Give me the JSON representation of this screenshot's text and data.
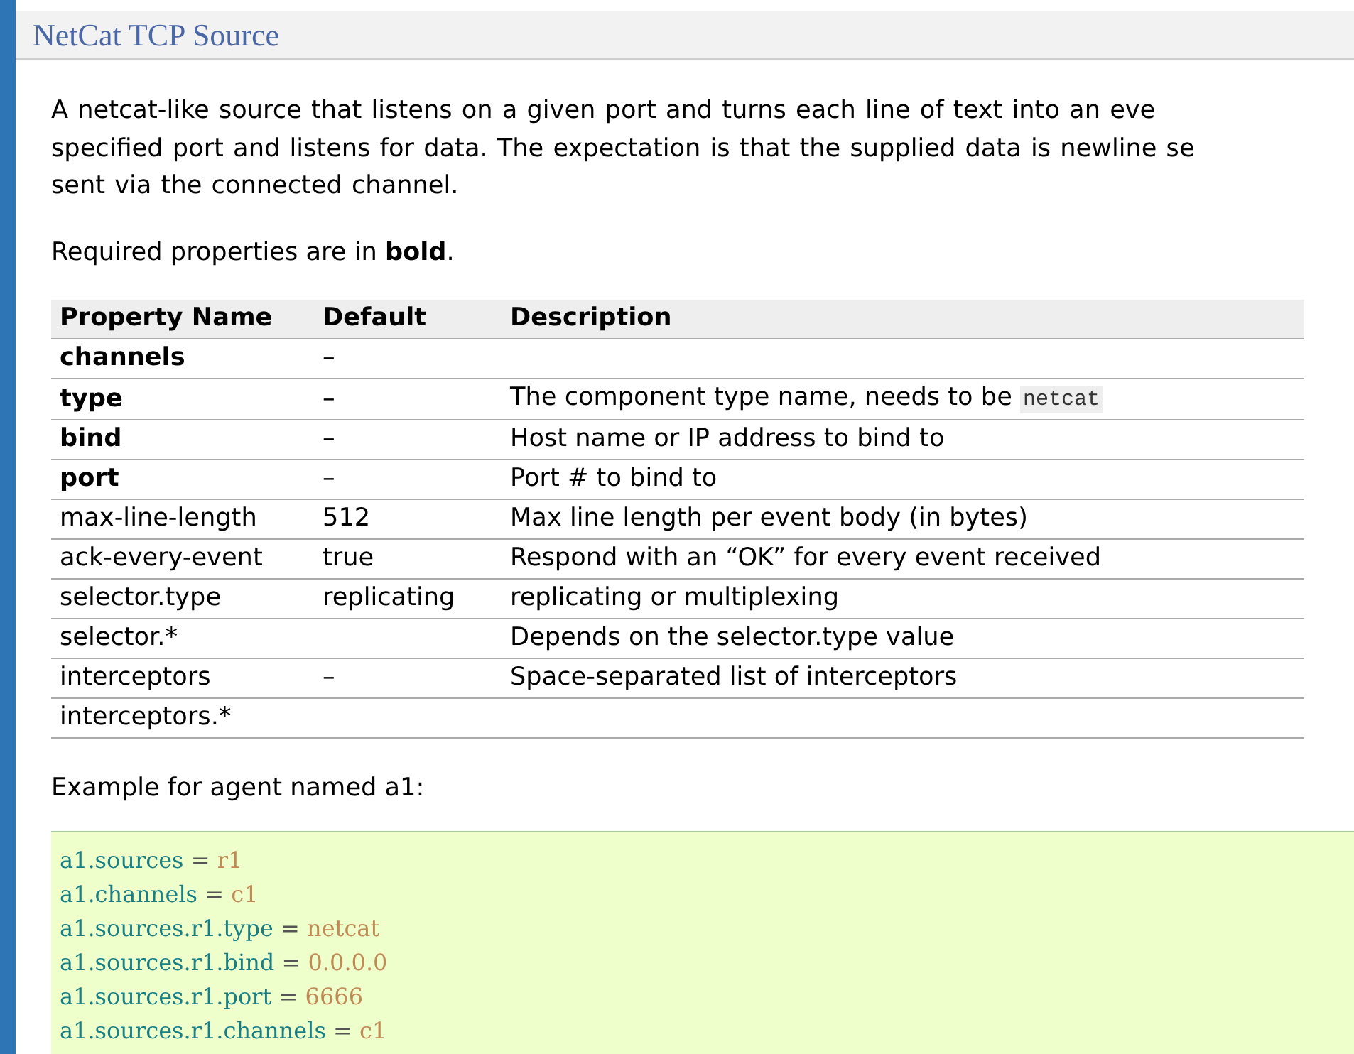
{
  "section": {
    "title": "NetCat TCP Source"
  },
  "intro": {
    "lines": [
      "A netcat-like source that listens on a given port and turns each line of text into an eve",
      "specified port and listens for data. The expectation is that the supplied data is newline se",
      "sent via the connected channel."
    ]
  },
  "required_note": "Required properties are in **bold**.",
  "table": {
    "columns": [
      "Property Name",
      "Default",
      "Description"
    ],
    "rows": [
      {
        "name": "channels",
        "required": true,
        "default": "–"
      },
      {
        "name": "type",
        "required": true,
        "default": "–",
        "description": "The component type name, needs to be",
        "code": "netcat"
      },
      {
        "name": "bind",
        "required": true,
        "default": "–",
        "description": "Host name or IP address to bind to"
      },
      {
        "name": "port",
        "required": true,
        "default": "–",
        "description": "Port # to bind to"
      },
      {
        "name": "max-line-length",
        "required": false,
        "default": "512",
        "description": "Max line length per event body (in bytes)"
      },
      {
        "name": "ack-every-event",
        "required": false,
        "default": "true",
        "description": "Respond with an “OK” for every event received"
      },
      {
        "name": "selector.type",
        "required": false,
        "default": "replicating",
        "description": "replicating or multiplexing"
      },
      {
        "name": "selector.*",
        "required": false,
        "description": "Depends on the selector.type value"
      },
      {
        "name": "interceptors",
        "required": false,
        "default": "–",
        "description": "Space-separated list of interceptors"
      },
      {
        "name": "interceptors.*",
        "required": false
      }
    ]
  },
  "example_label": "Example for agent named a1:",
  "code_lines": [
    {
      "key": "a1.sources",
      "operator": "=",
      "value": "r1"
    },
    {
      "key": "a1.channels",
      "operator": "=",
      "value": "c1"
    },
    {
      "key": "a1.sources.r1.type",
      "operator": "=",
      "value": "netcat"
    },
    {
      "key": "a1.sources.r1.bind",
      "operator": "=",
      "value": "0.0.0.0"
    },
    {
      "key": "a1.sources.r1.port",
      "operator": "=",
      "value": "6666"
    },
    {
      "key": "a1.sources.r1.channels",
      "operator": "=",
      "value": "c1"
    }
  ]
}
